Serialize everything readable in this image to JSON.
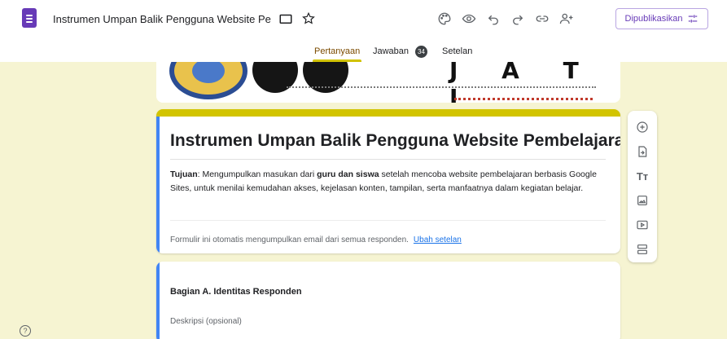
{
  "header": {
    "doc_title": "Instrumen Umpan Balik Pengguna Website Pe",
    "publish_label": "Dipublikasikan"
  },
  "icons": {
    "app": "forms-icon",
    "folder": "folder-icon",
    "star": "star-icon",
    "palette": "palette-icon",
    "preview": "eye-icon",
    "undo": "undo-icon",
    "redo": "redo-icon",
    "link": "link-icon",
    "collaborators": "add-person-icon",
    "publish": "tune-icon",
    "help": "help-icon"
  },
  "tabs": [
    {
      "label": "Pertanyaan",
      "active": true
    },
    {
      "label": "Jawaban",
      "count": "34"
    },
    {
      "label": "Setelan"
    }
  ],
  "banner": {
    "text": "J A T I"
  },
  "form": {
    "title": "Instrumen Umpan Balik Pengguna Website Pembelajaran",
    "desc_label": "Tujuan",
    "desc_part1": ": Mengumpulkan masukan dari ",
    "desc_bold": "guru dan siswa",
    "desc_part2": " setelah mencoba website pembelajaran berbasis Google Sites, untuk menilai kemudahan akses, kejelasan konten, tampilan, serta manfaatnya dalam kegiatan belajar.",
    "email_note": "Formulir ini otomatis mengumpulkan email dari semua responden.",
    "email_link": "Ubah setelan"
  },
  "section": {
    "title": "Bagian A. Identitas Responden",
    "description_placeholder": "Deskripsi (opsional)"
  },
  "sidebar_tools": [
    "add-question-icon",
    "import-questions-icon",
    "add-title-icon",
    "add-image-icon",
    "add-video-icon",
    "add-section-icon"
  ],
  "theme": {
    "accent": "#d2c400",
    "background": "#f6f4d2",
    "brand": "#673ab7",
    "card_edge": "#4285f4"
  }
}
